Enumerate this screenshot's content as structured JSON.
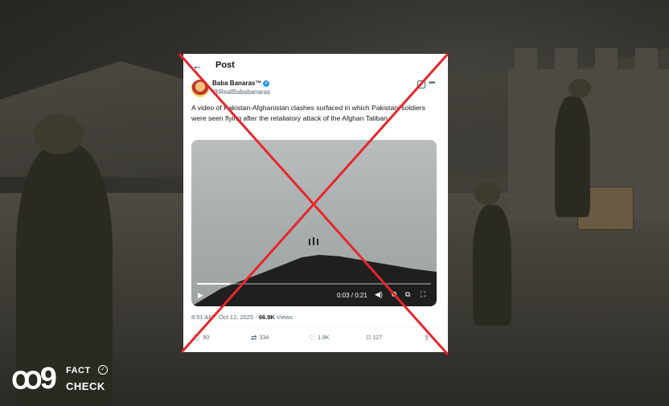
{
  "header": {
    "back_icon": "←",
    "title": "Post"
  },
  "tweet": {
    "display_name": "Baba Banaras™",
    "handle": "@RealBababanaras",
    "text": "A video of Pakistan-Afghanistan clashes surfaced in which Pakistani soldiers were seen flying after the retaliatory attack of the Afghan Taliban.",
    "video": {
      "time": "0:03 / 0:21",
      "progress": 0.14
    },
    "timestamp": "8:51 AM · Oct 12, 2025",
    "views_count": "66.9K",
    "views_label": "Views",
    "actions": {
      "replies": "50",
      "reposts": "334",
      "likes": "1.9K",
      "bookmarks": "127"
    }
  },
  "overlay": {
    "cross_color": "#e8262a"
  },
  "brand": {
    "mark": "ꝏ9",
    "line1": "FACT",
    "line2": "CHECK"
  }
}
